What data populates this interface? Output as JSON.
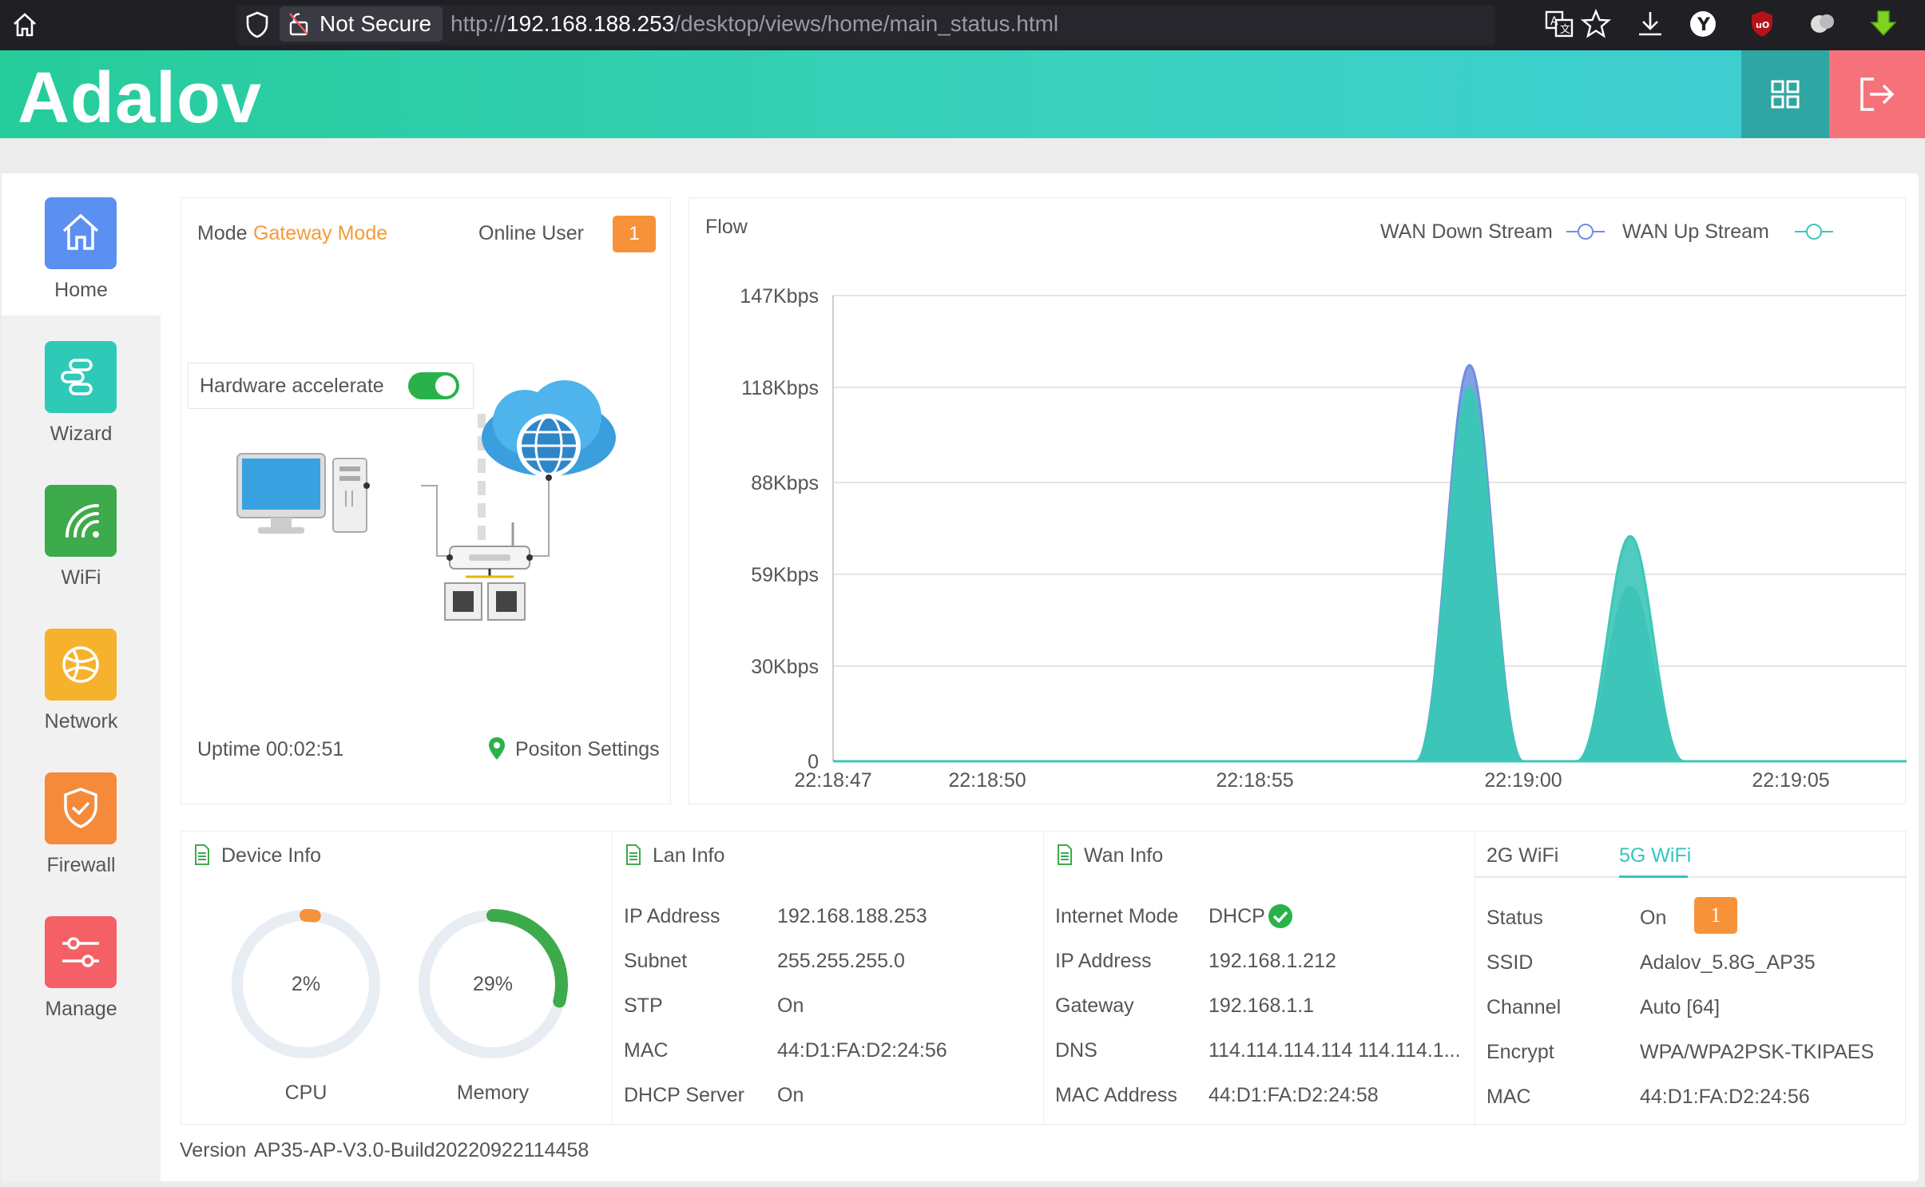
{
  "browser": {
    "not_secure": "Not Secure",
    "url_prefix": "http://",
    "url_host": "192.168.188.253",
    "url_path": "/desktop/views/home/main_status.html"
  },
  "app": {
    "logo": "Adalov"
  },
  "nav": [
    {
      "label": "Home",
      "color": "#5b8ff0",
      "icon": "home-icon"
    },
    {
      "label": "Wizard",
      "color": "#2fc9b8",
      "icon": "wizard-icon"
    },
    {
      "label": "WiFi",
      "color": "#3daa4b",
      "icon": "wifi-icon"
    },
    {
      "label": "Network",
      "color": "#f6b22c",
      "icon": "globe-icon"
    },
    {
      "label": "Firewall",
      "color": "#f58a3a",
      "icon": "shield-check-icon"
    },
    {
      "label": "Manage",
      "color": "#f46066",
      "icon": "sliders-icon"
    }
  ],
  "status": {
    "mode_label": "Mode",
    "mode_value": "Gateway Mode",
    "online_user_label": "Online User",
    "online_user_count": "1",
    "hw_accel_label": "Hardware accelerate",
    "hw_accel_on": true,
    "uptime_label": "Uptime",
    "uptime_value": "00:02:51",
    "position_settings": "Positon Settings"
  },
  "flow": {
    "title": "Flow",
    "legend_down": "WAN Down Stream",
    "legend_up": "WAN Up Stream"
  },
  "chart_data": {
    "type": "area",
    "title": "Flow",
    "x_ticks": [
      "22:18:47",
      "22:18:50",
      "22:18:55",
      "22:19:00",
      "22:19:05"
    ],
    "y_ticks": [
      "0",
      "30Kbps",
      "59Kbps",
      "88Kbps",
      "118Kbps",
      "147Kbps"
    ],
    "ylim": [
      0,
      147
    ],
    "x_unit_seconds_from": "22:18:47",
    "series": [
      {
        "name": "WAN Down Stream",
        "color": "#6f8fe0",
        "points": [
          [
            0,
            0
          ],
          [
            11,
            0
          ],
          [
            12,
            125
          ],
          [
            13,
            0
          ],
          [
            14,
            0
          ],
          [
            15,
            55
          ],
          [
            16,
            0
          ],
          [
            19.2,
            0
          ]
        ]
      },
      {
        "name": "WAN Up Stream",
        "color": "#3cc7b8",
        "points": [
          [
            0,
            0
          ],
          [
            11,
            0
          ],
          [
            12,
            118
          ],
          [
            13,
            0
          ],
          [
            14,
            0
          ],
          [
            15,
            71
          ],
          [
            16,
            0
          ],
          [
            19.2,
            0
          ]
        ]
      }
    ]
  },
  "device_info": {
    "title": "Device Info",
    "cpu_label": "CPU",
    "cpu_percent": 2,
    "cpu_text": "2%",
    "mem_label": "Memory",
    "mem_percent": 29,
    "mem_text": "29%"
  },
  "lan_info": {
    "title": "Lan Info",
    "rows": [
      {
        "k": "IP Address",
        "v": "192.168.188.253"
      },
      {
        "k": "Subnet",
        "v": "255.255.255.0"
      },
      {
        "k": "STP",
        "v": "On"
      },
      {
        "k": "MAC",
        "v": "44:D1:FA:D2:24:56"
      },
      {
        "k": "DHCP Server",
        "v": "On"
      }
    ]
  },
  "wan_info": {
    "title": "Wan Info",
    "rows": [
      {
        "k": "Internet Mode",
        "v": "DHCP"
      },
      {
        "k": "IP Address",
        "v": "192.168.1.212"
      },
      {
        "k": "Gateway",
        "v": "192.168.1.1"
      },
      {
        "k": "DNS",
        "v": "114.114.114.114 114.114.1..."
      },
      {
        "k": "MAC Address",
        "v": "44:D1:FA:D2:24:58"
      }
    ]
  },
  "wifi_info": {
    "tab_2g": "2G WiFi",
    "tab_5g": "5G WiFi",
    "status_label": "Status",
    "status_value": "On",
    "status_badge": "1",
    "rows": [
      {
        "k": "SSID",
        "v": "Adalov_5.8G_AP35"
      },
      {
        "k": "Channel",
        "v": "Auto [64]"
      },
      {
        "k": "Encrypt",
        "v": "WPA/WPA2PSK-TKIPAES"
      },
      {
        "k": "MAC",
        "v": "44:D1:FA:D2:24:56"
      }
    ]
  },
  "footer": {
    "version_label": "Version",
    "version_value": "AP35-AP-V3.0-Build20220922114458"
  }
}
